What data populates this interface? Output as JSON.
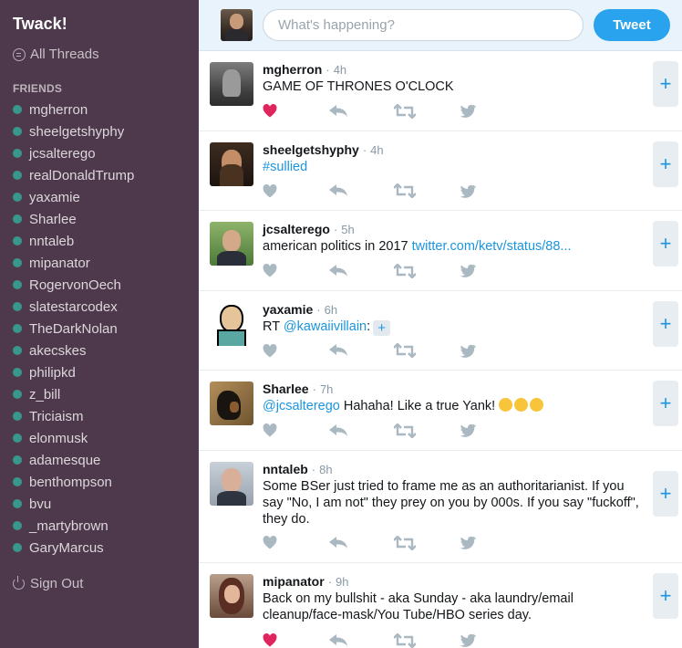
{
  "app": {
    "title": "Twack!"
  },
  "sidebar": {
    "all_threads_label": "All Threads",
    "friends_heading": "FRIENDS",
    "friends": [
      "mgherron",
      "sheelgetshyphy",
      "jcsalterego",
      "realDonaldTrump",
      "yaxamie",
      "Sharlee",
      "nntaleb",
      "mipanator",
      "RogervonOech",
      "slatestarcodex",
      "TheDarkNolan",
      "akecskes",
      "philipkd",
      "z_bill",
      "Triciaism",
      "elonmusk",
      "adamesque",
      "benthompson",
      "bvu",
      "_martybrown",
      "GaryMarcus"
    ],
    "sign_out_label": "Sign Out",
    "status_color": "#38978d"
  },
  "compose": {
    "placeholder": "What's happening?",
    "tweet_button": "Tweet"
  },
  "timeline": [
    {
      "handle": "mgherron",
      "time": "4h",
      "text": "GAME OF THRONES O'CLOCK",
      "liked": true
    },
    {
      "handle": "sheelgetshyphy",
      "time": "4h",
      "link": "#sullied",
      "liked": false
    },
    {
      "handle": "jcsalterego",
      "time": "5h",
      "text": "american politics in 2017 ",
      "link": "twitter.com/ketv/status/88...",
      "liked": false
    },
    {
      "handle": "yaxamie",
      "time": "6h",
      "text_prefix": "RT ",
      "mention": "@kawaiivillain",
      "text_suffix": ":",
      "liked": false
    },
    {
      "handle": "Sharlee",
      "time": "7h",
      "mention": "@jcsalterego",
      "text": " Hahaha! Like a true Yank!",
      "emojis": [
        "joy-emoji",
        "grimace-emoji",
        "wink-emoji"
      ],
      "liked": false
    },
    {
      "handle": "nntaleb",
      "time": "8h",
      "text": "Some BSer just tried to frame me as an authoritarianist. If you say \"No, I am not\" they prey on you by 000s. If you say \"fuckoff\", they do.",
      "liked": false
    },
    {
      "handle": "mipanator",
      "time": "9h",
      "text": "Back on my bullshit - aka Sunday - aka laundry/email cleanup/face-mask/You Tube/HBO series day.",
      "liked": true
    }
  ],
  "timestamp_separator": "·",
  "add_symbol": "+",
  "colors": {
    "sidebar_bg": "#4d394b",
    "accent": "#2aa3ef",
    "liked": "#e0245e",
    "action_icon": "#aab8c2"
  }
}
